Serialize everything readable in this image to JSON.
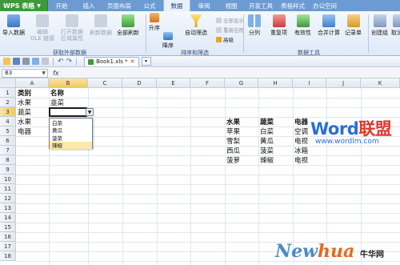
{
  "app": {
    "name": "WPS 表格"
  },
  "ribbon_tabs": [
    "开始",
    "插入",
    "页面布局",
    "公式",
    "数据",
    "审阅",
    "视图",
    "开发工具",
    "表格样式",
    "办公空间"
  ],
  "active_tab": "数据",
  "ribbon": {
    "items": {
      "import": "导入数据",
      "edit_ole": "编辑\nOLE 链接",
      "open_source": "打开数据\n区域属性",
      "refresh": "刷新数据",
      "refresh_all": "全部刷新",
      "sort_asc": "升序",
      "sort_desc": "降序",
      "autofilter": "自动筛选",
      "show_all": "全部显示",
      "reapply": "重新应用",
      "advanced": "高级",
      "split": "分列",
      "duplicates": "重复项",
      "validation": "有效性",
      "consolidate": "合并计算",
      "records": "记录单",
      "group": "创建组",
      "ungroup": "取消"
    },
    "groups": {
      "external": "获取外部数据",
      "sort_filter": "排序和筛选",
      "tools": "数据工具"
    }
  },
  "quickbar": {
    "doc_tab": "Book1.xls *"
  },
  "formula_bar": {
    "cell_ref": "B3",
    "fx": "fx"
  },
  "grid": {
    "columns": [
      "A",
      "B",
      "C",
      "D",
      "E",
      "F",
      "G",
      "H",
      "I",
      "J",
      "K"
    ],
    "rows": [
      "1",
      "2",
      "3",
      "4",
      "5",
      "6",
      "7",
      "8",
      "9",
      "10",
      "11",
      "12",
      "13",
      "14",
      "15",
      "16",
      "17",
      "18"
    ],
    "selected_cell": {
      "col": "B",
      "row": "3"
    }
  },
  "cells": {
    "A1": "类别",
    "B1": "名称",
    "A2": "水果",
    "B2": "韭菜",
    "A3": "蔬菜",
    "A4": "水果",
    "A5": "电器",
    "G4": "水果",
    "H4": "蔬菜",
    "I4": "电器",
    "G5": "苹果",
    "H5": "白菜",
    "I5": "空调",
    "G6": "雪梨",
    "H6": "黄瓜",
    "I6": "电视",
    "G7": "西瓜",
    "H7": "菠菜",
    "I7": "冰箱",
    "G8": "菠萝",
    "H8": "辣椒",
    "I8": "电视"
  },
  "dropdown": {
    "options": [
      "白菜",
      "黄瓜",
      "菠菜",
      "辣椒"
    ],
    "highlighted_index": 3
  },
  "watermarks": {
    "word_a": "Word",
    "word_b": "联盟",
    "url": "www.wordlm.com",
    "newhua_a": "New",
    "newhua_b": "hua",
    "newhua_cn": "牛华网"
  },
  "colors": {
    "tabbar": "#6b9bd2",
    "app_button": "#3d9a3a",
    "selection_header": "#f1c85e",
    "dropdown_highlight": "#ffe9a8"
  }
}
